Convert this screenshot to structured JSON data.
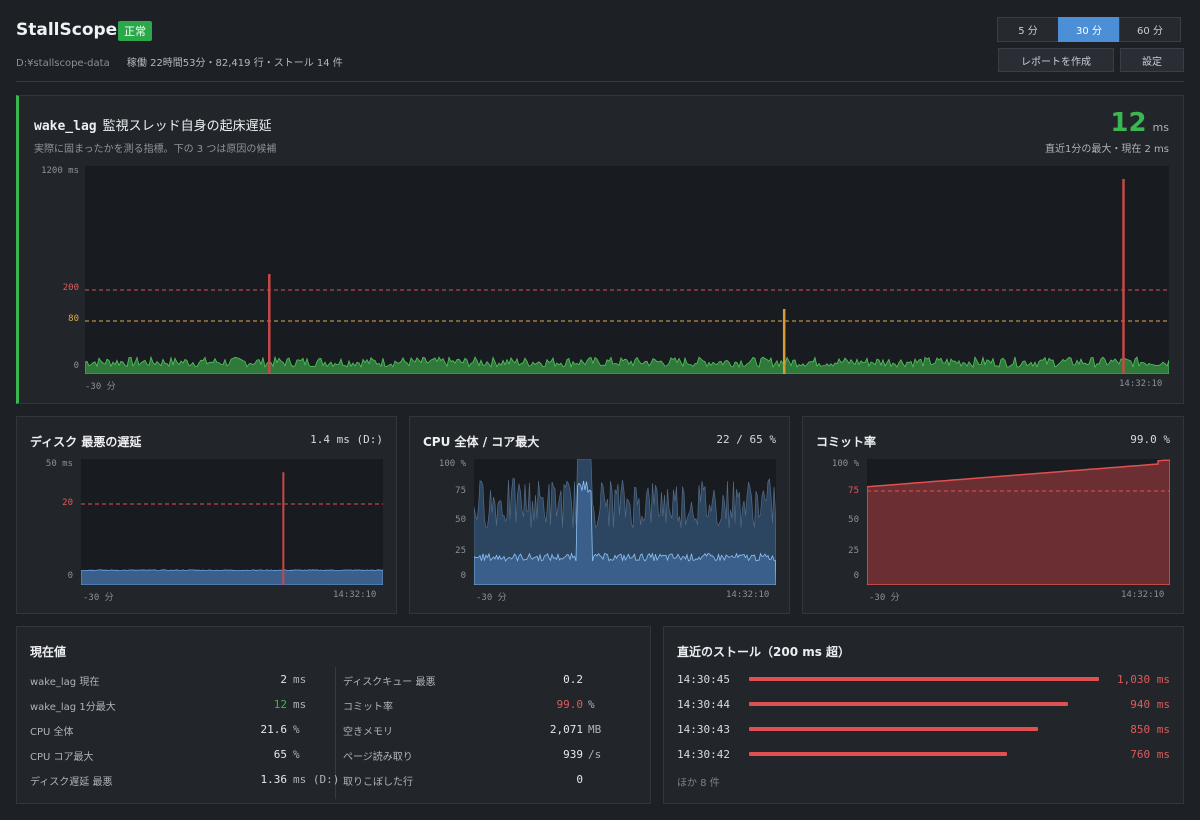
{
  "header": {
    "app_title": "StallScope",
    "status": "正常",
    "path": "D:¥stallscope-data",
    "meta": "稼働 22時間53分・82,419 行・ストール 14 件",
    "range_options": [
      "5 分",
      "30 分",
      "60 分"
    ],
    "range_selected": "30 分",
    "report_button": "レポートを作成",
    "settings_button": "設定"
  },
  "wake": {
    "key": "wake_lag",
    "title": "監視スレッド自身の起床遅延",
    "subtitle": "実際に固まったかを測る指標。下の 3 つは原因の候補",
    "value": "12",
    "unit": "ms",
    "value_sub": "直近1分の最大・現在 2 ms",
    "y_top": "1200 ms",
    "y_zero": "0",
    "threshold_crit": "200",
    "threshold_warn": "80",
    "x_start": "-30 分",
    "x_end": "14:32:10"
  },
  "disk": {
    "title": "ディスク 最悪の遅延",
    "value": "1.4 ms (D:)",
    "y_top": "50 ms",
    "threshold": "20",
    "y_zero": "0",
    "x_start": "-30 分",
    "x_end": "14:32:10"
  },
  "cpu": {
    "title": "CPU 全体 / コア最大",
    "value": "22 / 65 %",
    "y_ticks": [
      "100 %",
      "75",
      "50",
      "25",
      "0"
    ],
    "x_start": "-30 分",
    "x_end": "14:32:10"
  },
  "commit": {
    "title": "コミット率",
    "value": "99.0 %",
    "y_ticks": [
      "100 %",
      "75",
      "50",
      "25",
      "0"
    ],
    "x_start": "-30 分",
    "x_end": "14:32:10"
  },
  "current": {
    "title": "現在値",
    "left": [
      {
        "label": "wake_lag 現在",
        "value": "2",
        "unit": "ms"
      },
      {
        "label": "wake_lag 1分最大",
        "value": "12",
        "unit": "ms"
      },
      {
        "label": "CPU 全体",
        "value": "21.6",
        "unit": "%"
      },
      {
        "label": "CPU コア最大",
        "value": "65",
        "unit": "%"
      },
      {
        "label": "ディスク遅延 最悪",
        "value": "1.36",
        "unit": "ms (D:)"
      }
    ],
    "right": [
      {
        "label": "ディスクキュー 最悪",
        "value": "0.2",
        "unit": ""
      },
      {
        "label": "コミット率",
        "value": "99.0",
        "unit": "%"
      },
      {
        "label": "空きメモリ",
        "value": "2,071",
        "unit": "MB"
      },
      {
        "label": "ページ読み取り",
        "value": "939",
        "unit": "/s"
      },
      {
        "label": "取りこぼした行",
        "value": "0",
        "unit": ""
      }
    ]
  },
  "stalls": {
    "title": "直近のストール（200 ms 超）",
    "items": [
      {
        "time": "14:30:45",
        "value": "1,030 ms",
        "ms": 1030
      },
      {
        "time": "14:30:44",
        "value": "940 ms",
        "ms": 940
      },
      {
        "time": "14:30:43",
        "value": "850 ms",
        "ms": 850
      },
      {
        "time": "14:30:42",
        "value": "760 ms",
        "ms": 760
      }
    ],
    "more": "ほか 8 件"
  },
  "colors": {
    "ok": "#3cb650",
    "accent": "#4d8fd6",
    "warn": "#e0a84a",
    "crit": "#e05050",
    "cpu_fill": "#3a5f8a",
    "commit_fill": "#6b2e33"
  },
  "chart_data": [
    {
      "type": "area",
      "title": "wake_lag",
      "ylim": [
        0,
        1200
      ],
      "unit": "ms",
      "thresholds": [
        200,
        80
      ],
      "x_range": [
        "-30 分",
        "14:32:10"
      ],
      "baseline_range": [
        5,
        15
      ],
      "spikes": [
        {
          "x_frac": 0.17,
          "y": 630
        },
        {
          "x_frac": 0.645,
          "y": 400
        },
        {
          "x_frac": 0.958,
          "y": 1030
        }
      ]
    },
    {
      "type": "area",
      "title": "ディスク 最悪の遅延",
      "ylim": [
        0,
        50
      ],
      "unit": "ms",
      "thresholds": [
        20
      ],
      "baseline": 1.4,
      "spikes": [
        {
          "x_frac": 0.67,
          "y": 47
        }
      ]
    },
    {
      "type": "area",
      "title": "CPU 全体 / コア最大",
      "ylim": [
        0,
        100
      ],
      "series": [
        {
          "name": "全体",
          "baseline": 22
        },
        {
          "name": "コア最大",
          "baseline": 65
        }
      ],
      "busy_window": [
        0.34,
        0.39
      ]
    },
    {
      "type": "area",
      "title": "コミット率",
      "ylim": [
        0,
        100
      ],
      "thresholds": [
        75
      ],
      "start": 78,
      "end": 99
    }
  ]
}
